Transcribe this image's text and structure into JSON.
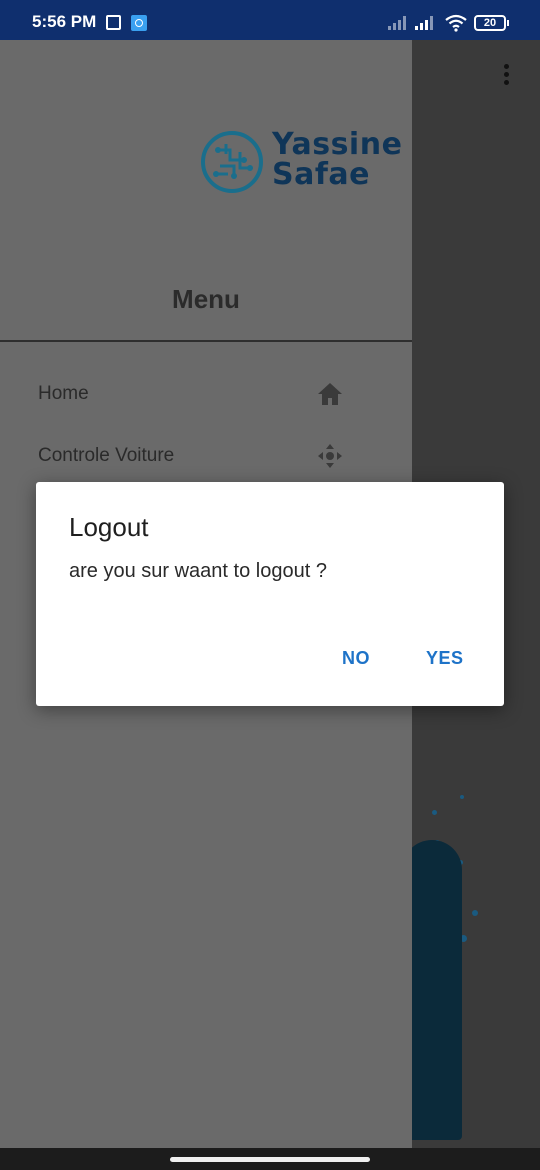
{
  "status_bar": {
    "time": "5:56 PM",
    "battery": "20",
    "icons": [
      "grid-icon",
      "app-icon",
      "signal-icon",
      "signal-icon",
      "wifi-icon",
      "battery-icon"
    ]
  },
  "drawer": {
    "logo": {
      "line1": "Yassine",
      "line2": "Safae"
    },
    "menu_title": "Menu",
    "items": [
      {
        "label": "Home",
        "icon": "home-icon"
      },
      {
        "label": "Controle Voiture",
        "icon": "move-icon"
      }
    ]
  },
  "dialog": {
    "title": "Logout",
    "message": "are you sur waant to logout ?",
    "no_label": "NO",
    "yes_label": "YES"
  },
  "colors": {
    "status_bar": "#0f2f6e",
    "drawer_bg_dimmed": "#6a6a6a",
    "logo": "#0f3558",
    "accent": "#1e73c8"
  }
}
